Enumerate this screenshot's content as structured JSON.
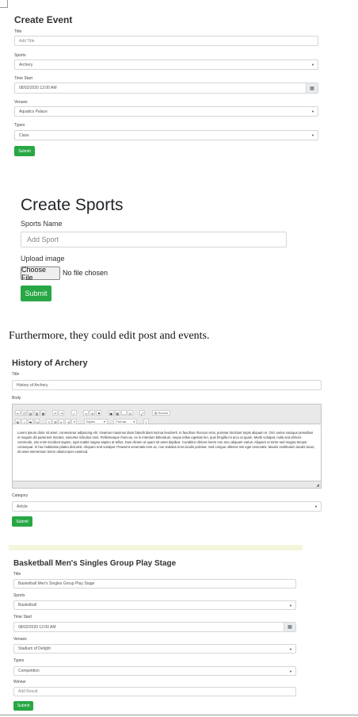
{
  "event_form": {
    "heading": "Create Event",
    "title_label": "Title",
    "title_placeholder": "Add Title",
    "sports_label": "Sports",
    "sports_value": "Archery",
    "time_label": "Time Start",
    "time_value": "08/02/2020 12:00 AM",
    "venues_label": "Venues",
    "venues_value": "Aquatics Palace",
    "types_label": "Types",
    "types_value": "Class",
    "submit_label": "Submit"
  },
  "sports_form": {
    "heading": "Create Sports",
    "name_label": "Sports Name",
    "name_placeholder": "Add Sport",
    "upload_label": "Upload image",
    "choose_file_label": "Choose File",
    "no_file_text": "No file chosen",
    "submit_label": "Submit"
  },
  "narrative": {
    "text": "Furthermore, they could edit post and events."
  },
  "post_form": {
    "heading": "History of Archery",
    "title_label": "Title",
    "title_value": "History of Archery",
    "body_label": "Body",
    "toolbar": {
      "source_label": "Source",
      "styles_label": "Styles",
      "format_label": "Format"
    },
    "body_text": "Lorem ipsum dolor sit amet, consectetur adipiscing elit. Vivamus maximus diam blandit diam lacinia hendrerit. In faucibus rhoncus eros, pulvinar tincidunt turpis aliquam et. Orci varius natoque penatibus et magnis dis parturient montes, nascetur ridiculus mus. Pellentesque rhoncus, ex in interdum bibendum, neque tellus egestas leo, quis fringilla mi arcu ut quam. Morbi volutpat, nulla sed ultrices commodo, nisi enim tincidunt sapien, eget mattis magna sapien at tellus. Duis dictum ut quam sit amet dapibus. Curabitur ultrices lorem non arcu aliquam varius. Aliquam ut tortor sed magna tempor consequat. In hac habitasse platea dictumst. Aliquam erat volutpat. Praesent venenatis eros ac, non sodales eros iaculis pulvinar. Sed congue ultricies nisi eget venenatis. Mauris vestibulum iaculis lacus, sit amet elementum lorem ullamcorper euismod.",
    "category_label": "Category",
    "category_value": "Article",
    "submit_label": "Submit"
  },
  "edit_event_form": {
    "heading": "Basketball Men's Singles Group Play Stage",
    "title_label": "Title",
    "title_value": "Basketball Men's Singles Group Play Stage",
    "sports_label": "Sports",
    "sports_value": "Basketball",
    "time_label": "Time Start",
    "time_value": "08/02/2020 12:00 AM",
    "venues_label": "Venues",
    "venues_value": "Stadium of Delight",
    "types_label": "Types",
    "types_value": "Competition",
    "winner_label": "Winner",
    "winner_placeholder": "Add Result",
    "submit_label": "Submit"
  },
  "icons": {
    "calendar": "calendar-icon",
    "dropdown": "chevron-down-icon",
    "resize": "resize-handle-icon"
  },
  "colors": {
    "submit_green": "#28a745",
    "toolbar_bg": "#e9e9e9",
    "strip_bg": "#f5f5dc"
  }
}
